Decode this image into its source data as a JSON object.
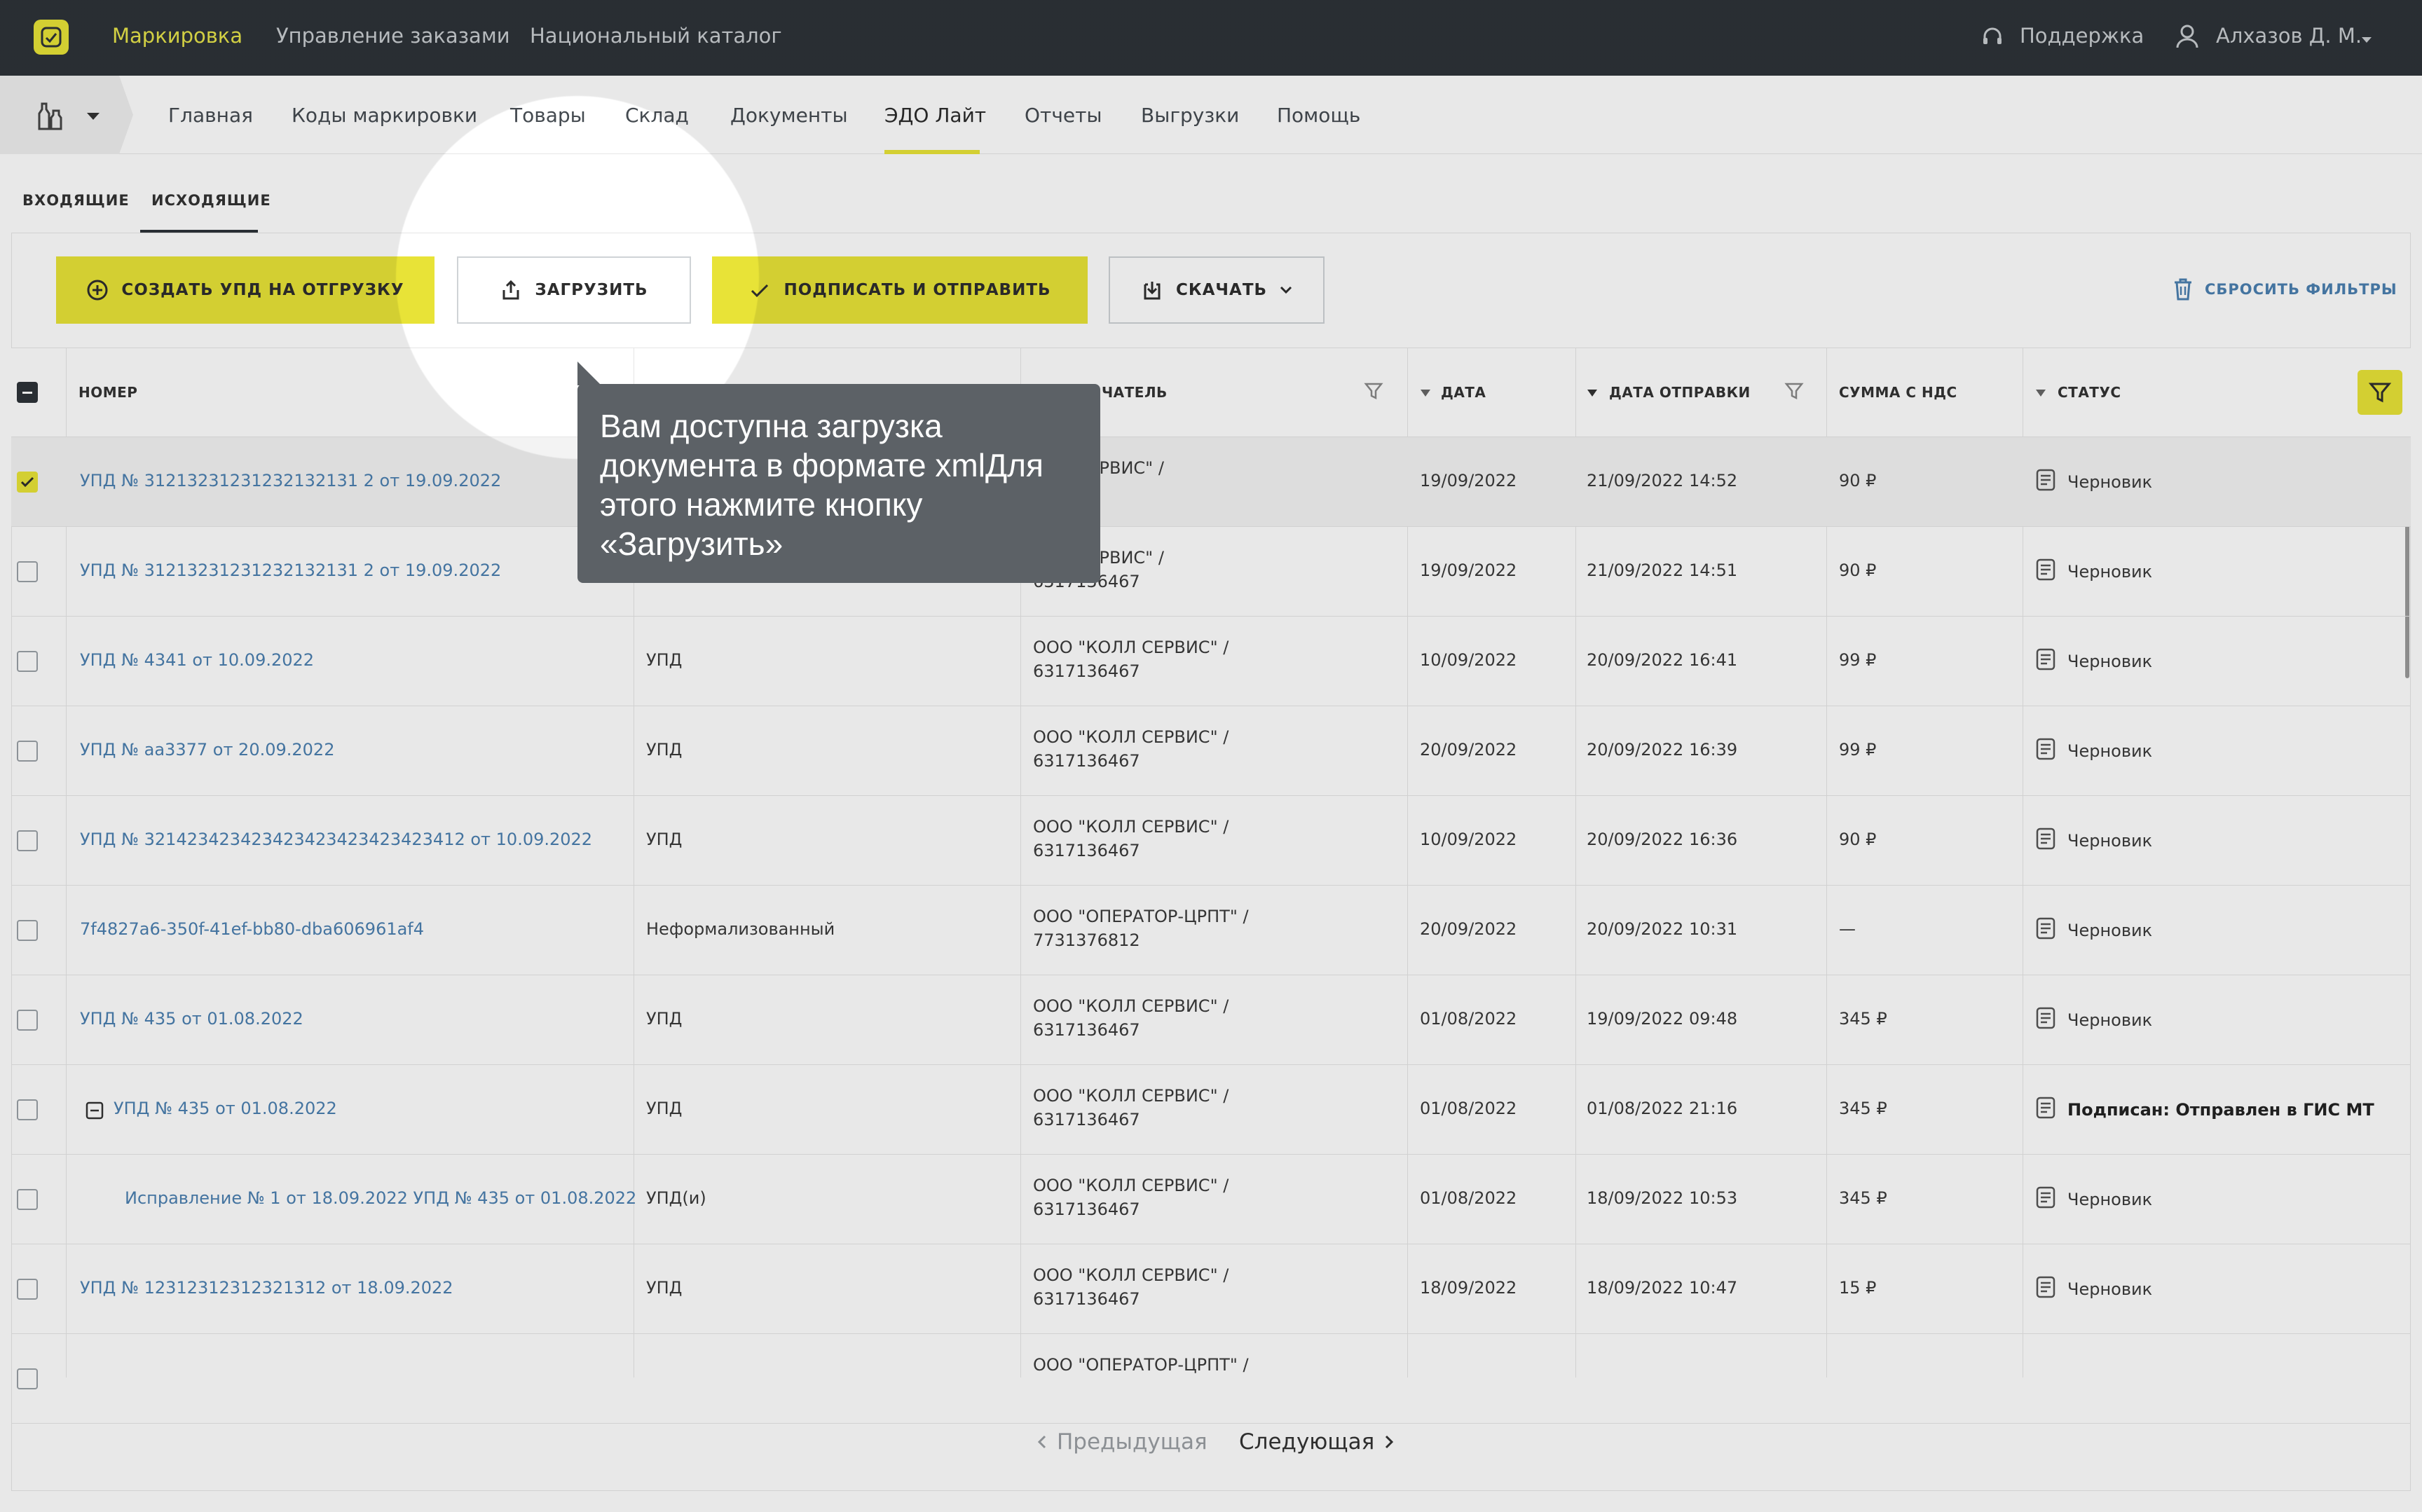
{
  "topbar": {
    "nav": [
      "Маркировка",
      "Управление заказами",
      "Национальный каталог"
    ],
    "support": "Поддержка",
    "user": "Алхазов Д. М."
  },
  "subnav": [
    "Главная",
    "Коды маркировки",
    "Товары",
    "Склад",
    "Документы",
    "ЭДО Лайт",
    "Отчеты",
    "Выгрузки",
    "Помощь"
  ],
  "tabs": [
    "ВХОДЯЩИЕ",
    "ИСХОДЯЩИЕ"
  ],
  "toolbar": {
    "create": "СОЗДАТЬ УПД НА ОТГРУЗКУ",
    "upload": "ЗАГРУЗИТЬ",
    "sign": "ПОДПИСАТЬ И ОТПРАВИТЬ",
    "download": "СКАЧАТЬ",
    "reset": "СБРОСИТЬ ФИЛЬТРЫ"
  },
  "columns": {
    "number": "НОМЕР",
    "recipient": "ЧАТЕЛЬ",
    "date": "ДАТА",
    "sent": "ДАТА ОТПРАВКИ",
    "sum": "СУММА С НДС",
    "status": "СТАТУС"
  },
  "rows": [
    {
      "number": "УПД № 31213231231232132131 2 от 19.09.2022",
      "type": "",
      "rec1": "ОЛЛ СЕРВИС\" /",
      "rec2": "36467",
      "date": "19/09/2022",
      "sent": "21/09/2022 14:52",
      "sum": "90 ₽",
      "status": "Черновик"
    },
    {
      "number": "УПД № 31213231231232132131 2 от 19.09.2022",
      "type": "",
      "rec1": "ОЛЛ СЕРВИС\" /",
      "rec2": "6317136467",
      "date": "19/09/2022",
      "sent": "21/09/2022 14:51",
      "sum": "90 ₽",
      "status": "Черновик"
    },
    {
      "number": "УПД № 4341 от 10.09.2022",
      "type": "УПД",
      "rec1": "ООО \"КОЛЛ СЕРВИС\" /",
      "rec2": "6317136467",
      "date": "10/09/2022",
      "sent": "20/09/2022 16:41",
      "sum": "99 ₽",
      "status": "Черновик"
    },
    {
      "number": "УПД № aa3377 от 20.09.2022",
      "type": "УПД",
      "rec1": "ООО \"КОЛЛ СЕРВИС\" /",
      "rec2": "6317136467",
      "date": "20/09/2022",
      "sent": "20/09/2022 16:39",
      "sum": "99 ₽",
      "status": "Черновик"
    },
    {
      "number": "УПД № 321423423423423423423423423412 от 10.09.2022",
      "type": "УПД",
      "rec1": "ООО \"КОЛЛ СЕРВИС\" /",
      "rec2": "6317136467",
      "date": "10/09/2022",
      "sent": "20/09/2022 16:36",
      "sum": "90 ₽",
      "status": "Черновик"
    },
    {
      "number": "7f4827a6-350f-41ef-bb80-dba606961af4",
      "type": "Неформализованный",
      "rec1": "ООО \"ОПЕРАТОР-ЦРПТ\" /",
      "rec2": "7731376812",
      "date": "20/09/2022",
      "sent": "20/09/2022 10:31",
      "sum": "—",
      "status": "Черновик"
    },
    {
      "number": "УПД № 435 от 01.08.2022",
      "type": "УПД",
      "rec1": "ООО \"КОЛЛ СЕРВИС\" /",
      "rec2": "6317136467",
      "date": "01/08/2022",
      "sent": "19/09/2022 09:48",
      "sum": "345 ₽",
      "status": "Черновик"
    },
    {
      "number": "УПД № 435 от 01.08.2022",
      "type": "УПД",
      "rec1": "ООО \"КОЛЛ СЕРВИС\" /",
      "rec2": "6317136467",
      "date": "01/08/2022",
      "sent": "01/08/2022 21:16",
      "sum": "345 ₽",
      "status": "Подписан: Отправлен в ГИС МТ"
    },
    {
      "number": "Исправление № 1 от 18.09.2022 УПД № 435 от 01.08.2022",
      "type": "УПД(и)",
      "rec1": "ООО \"КОЛЛ СЕРВИС\" /",
      "rec2": "6317136467",
      "date": "01/08/2022",
      "sent": "18/09/2022 10:53",
      "sum": "345 ₽",
      "status": "Черновик"
    },
    {
      "number": "УПД № 12312312312321312 от 18.09.2022",
      "type": "УПД",
      "rec1": "ООО \"КОЛЛ СЕРВИС\" /",
      "rec2": "6317136467",
      "date": "18/09/2022",
      "sent": "18/09/2022 10:47",
      "sum": "15 ₽",
      "status": "Черновик"
    },
    {
      "number": "",
      "type": "",
      "rec1": "ООО \"ОПЕРАТОР-ЦРПТ\" /",
      "rec2": "",
      "date": "",
      "sent": "",
      "sum": "",
      "status": ""
    }
  ],
  "pagination": {
    "prev": "Предыдущая",
    "next": "Следующая"
  },
  "tooltip": {
    "line1": "Вам доступна загрузка",
    "line2": "документа в формате xmlДля",
    "line3": "этого нажмите кнопку",
    "line4": "«Загрузить»"
  },
  "colors": {
    "accent": "#e8e337",
    "topbar": "#2d3238",
    "link": "#4b7fb0"
  }
}
